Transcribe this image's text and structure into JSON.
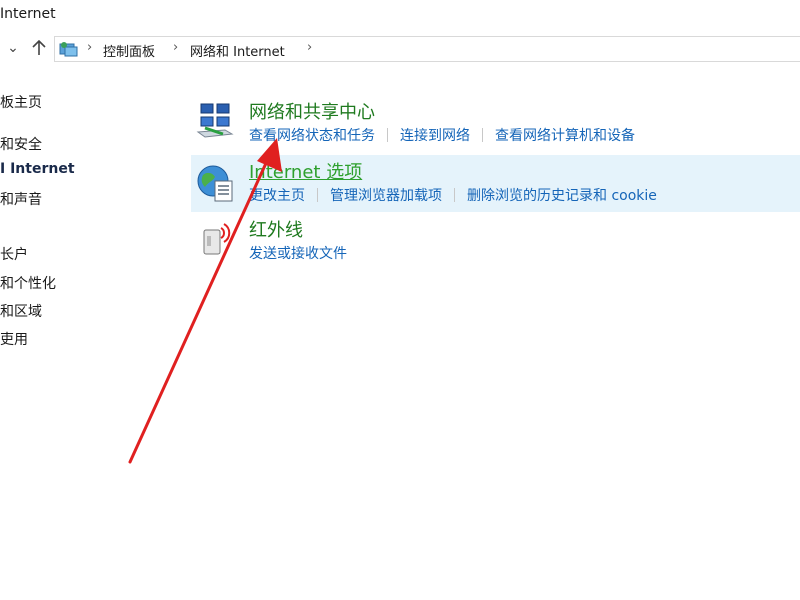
{
  "window": {
    "title": "Internet"
  },
  "nav": {
    "breadcrumb": [
      "控制面板",
      "网络和 Internet"
    ]
  },
  "sidebar": {
    "items": [
      {
        "label": "板主页"
      },
      {
        "label": "和安全"
      },
      {
        "label": "I Internet",
        "active": true
      },
      {
        "label": "和声音"
      },
      {
        "label": "长户"
      },
      {
        "label": "和个性化"
      },
      {
        "label": "和区域"
      },
      {
        "label": "吏用"
      }
    ]
  },
  "categories": [
    {
      "title": "网络和共享中心",
      "icon": "network-center-icon",
      "links": [
        "查看网络状态和任务",
        "连接到网络",
        "查看网络计算机和设备"
      ]
    },
    {
      "title": "Internet 选项",
      "icon": "internet-options-globe-icon",
      "links": [
        "更改主页",
        "管理浏览器加载项",
        "删除浏览的历史记录和 cookie"
      ]
    },
    {
      "title": "红外线",
      "icon": "infrared-icon",
      "links": [
        "发送或接收文件"
      ]
    }
  ],
  "colors": {
    "category_title": "#1f7a1f",
    "link": "#1565b8",
    "highlight": "#e5f3fb",
    "annotation_arrow": "#e02020"
  }
}
